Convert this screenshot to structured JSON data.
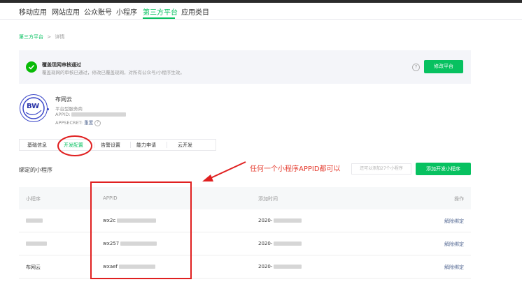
{
  "nav": {
    "items": [
      "移动应用",
      "网站应用",
      "公众账号",
      "小程序",
      "第三方平台",
      "应用类目"
    ]
  },
  "breadcrumb": {
    "parent": "第三方平台",
    "sep": ">",
    "current": "详情"
  },
  "banner": {
    "title": "覆盖现网审核通过",
    "desc": "覆盖现网的审核已通过，修改已覆盖现网，对所有公众号/小程序生效。",
    "button": "修改平台"
  },
  "platform": {
    "name": "布网云",
    "type": "平台型服务商",
    "appid_label": "APPID:",
    "appsecret_label": "APPSECRET:",
    "reset": "重置",
    "logo_text": "BW"
  },
  "tabs": [
    "基础信息",
    "开发配置",
    "告警设置",
    "能力申请",
    "云开发"
  ],
  "section": {
    "title": "绑定的小程序",
    "annotation": "任何一个小程序APPID都可以",
    "hint": "还可以添加27个小程序",
    "add_button": "添加开发小程序"
  },
  "table": {
    "headers": [
      "小程序",
      "APPID",
      "添加时间",
      "操作"
    ],
    "rows": [
      {
        "name": "",
        "appid": "wx2c",
        "time": "2020-",
        "op": "解除绑定"
      },
      {
        "name": "",
        "appid": "wx257",
        "time": "2020-",
        "op": "解除绑定"
      },
      {
        "name": "布网云",
        "appid": "wxaef",
        "time": "2020-",
        "op": "解除绑定"
      }
    ]
  },
  "colors": {
    "accent": "#07c160",
    "link": "#576b95",
    "annotation": "#e02020"
  }
}
